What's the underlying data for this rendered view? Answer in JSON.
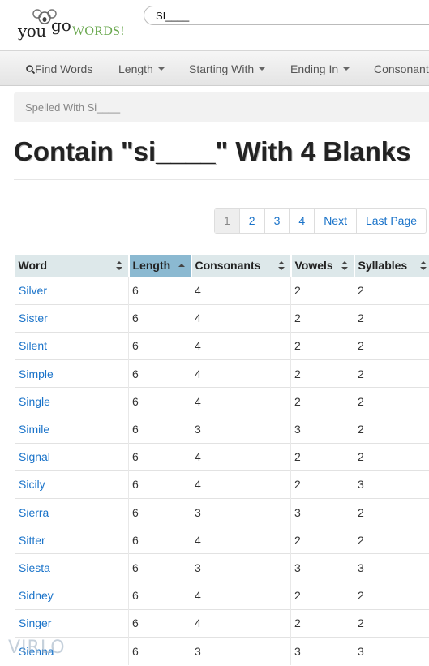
{
  "logo": {
    "you": "you",
    "go": "go",
    "words": "WORDS!"
  },
  "search": {
    "value": "SI____"
  },
  "nav": {
    "find_words": "Find Words",
    "length": "Length",
    "starting_with": "Starting With",
    "ending_in": "Ending In",
    "consonants": "Consonants"
  },
  "breadcrumb": "Spelled With Si____",
  "page_title": "Contain \"si____\" With 4 Blanks",
  "pagination": [
    "1",
    "2",
    "3",
    "4",
    "Next",
    "Last Page"
  ],
  "table": {
    "headers": [
      "Word",
      "Length",
      "Consonants",
      "Vowels",
      "Syllables"
    ],
    "sorted_column": "Length",
    "rows": [
      [
        "Silver",
        "6",
        "4",
        "2",
        "2"
      ],
      [
        "Sister",
        "6",
        "4",
        "2",
        "2"
      ],
      [
        "Silent",
        "6",
        "4",
        "2",
        "2"
      ],
      [
        "Simple",
        "6",
        "4",
        "2",
        "2"
      ],
      [
        "Single",
        "6",
        "4",
        "2",
        "2"
      ],
      [
        "Simile",
        "6",
        "3",
        "3",
        "2"
      ],
      [
        "Signal",
        "6",
        "4",
        "2",
        "2"
      ],
      [
        "Sicily",
        "6",
        "4",
        "2",
        "3"
      ],
      [
        "Sierra",
        "6",
        "3",
        "3",
        "2"
      ],
      [
        "Sitter",
        "6",
        "4",
        "2",
        "2"
      ],
      [
        "Siesta",
        "6",
        "3",
        "3",
        "3"
      ],
      [
        "Sidney",
        "6",
        "4",
        "2",
        "2"
      ],
      [
        "Singer",
        "6",
        "4",
        "2",
        "2"
      ],
      [
        "Sienna",
        "6",
        "3",
        "3",
        "3"
      ]
    ]
  },
  "watermark": "VIRLO",
  "colors": {
    "link": "#1a73c9",
    "header": "#dde8ea",
    "sorted_header": "#8bb9d1",
    "logo_green": "#6aa84f"
  }
}
